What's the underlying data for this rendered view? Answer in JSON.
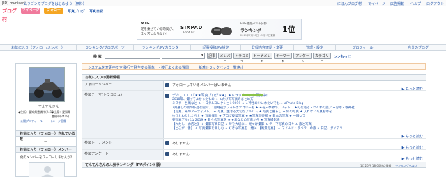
{
  "topbar": {
    "user_id": "[ID] munisani",
    "tagline": "ムラゴンでブログをはじめよう（無料）",
    "links": [
      "にほんブログ村",
      "マイページ",
      "広告掲載",
      "ヘルプ",
      "ログアウト"
    ]
  },
  "nav": {
    "logo": "ブログ村",
    "mypage": "マイページ",
    "follow": "フォロー",
    "photoblog": "写真ブログ",
    "photodiary": "写真日記"
  },
  "ad": {
    "brand": "MTG",
    "text1": "足を乗せている時間が、",
    "text2": "全く苦にならない！",
    "product": "SIXPAD",
    "product_sub": "Foot Fit",
    "product_label": "EMS 腹筋ベルト分野",
    "rank_label": "ランキング",
    "rank_value": "1位",
    "rank_note": "2019年7月16日〜9月13日更新"
  },
  "tabs": [
    "お気に入り（フォロー/メンバー）",
    "ランキング/ブログパーツ",
    "ランキング/PVカウンター",
    "記事投稿/PV設定",
    "登録内容確認・変更",
    "管理・設定",
    "プロフィール",
    "自分のブログ"
  ],
  "search": {
    "label": "検 索",
    "buttons": [
      "記事",
      "メンバー",
      "トラコミュ",
      "トーナメント",
      "キーワード",
      "アンケート",
      "カテゴリー"
    ],
    "more": ">>もっと"
  },
  "notice": {
    "items": [
      "・システムを変更中です",
      "・移行で発生する現象",
      "・移行よくある質問",
      "・新着トラックバック一覧停止"
    ]
  },
  "profile": {
    "name": "てんてんさん",
    "detail1": "◆住所：愛知県豊橋市(2419)",
    "detail1b": "◆出身：愛知県",
    "detail2": "豊橋市(2419)",
    "links": [
      "公開プロフィール",
      "イメージ画像"
    ]
  },
  "sidebar": {
    "sec1": "お気に入り（フォロー）されている数",
    "sec1_value": "ー",
    "sec2": "お気に入り（フォロー）メンバー",
    "sec2_text": "他のメンバーをフォローしませんか？"
  },
  "main": {
    "section1": "お気に入りの更新情報",
    "rows": [
      {
        "label": "フォローメンバー",
        "value": "フォローしているメンバーはいません",
        "more": "▶ もっと読む"
      },
      {
        "label": "参加テーマ(トラコミュ)",
        "value": "デカし・・・「★★写真ブログ★★」★トラックバック募集中！",
        "more": "▶ もっと読む"
      },
      {
        "label": "参加トーナメント",
        "value": "ありません",
        "more": "▶ もっと読む"
      },
      {
        "label": "参加アンケート",
        "value": "ありません",
        "more": "▶ もっと読む"
      }
    ],
    "theme_lines": [
      "2018年、撮ってよかったもの ☆ ★たびの写真のまとめ方",
      "ミスター台風など ★ トヨタ&コレクション2019 ★ ★神社のいいわたいでも… ★Photo Blog",
      "7月通しの景の作品を紹介、1月月夜がフォトカテゴリーも ★ ★花・季節の、フォト… ★町を巡る・わくわく旅ア ★お寺・寺神社",
      "【写真、光のアーティスト】 ★ 写真、生きる大切なアルバム ★ 写真と暮らし ★ 何の写真 ★ 入れない写真お寺を…",
      "ゆりとわたしたちと ★ 写真作品 ★ ブログ投稿写真 ★ ★写真倶楽部 ★ 日本の写真 ★ 一眼レフ",
      "夢写真アルバム 2019 ★ 日々の写真を ★ ★あなたの写真から ★ 写真撮影機",
      "【わたし・お店と】 ★ 撮影写真日記 ★ 時を大切に… 見つけ撮影 ★ テーマ写真の日々 ★ 旅と写真",
      "【どこが一番】 ★ 写真撮影を楽しむ ★ 好きな写真を一緒に 【風景写真】 ★ マイルドトラベラーの旅 ★ 日記・ダイアリー"
    ],
    "section2": "てんてんさんの人気ランキング（PVポイント順）",
    "section2_date": "1月26日 18:00時点情報",
    "section2_more": "ランキングヘルプ"
  },
  "colors": {
    "pink": "#f07a9c",
    "orange": "#f5a623",
    "blue": "#2255aa",
    "green": "#3a9d3a"
  }
}
